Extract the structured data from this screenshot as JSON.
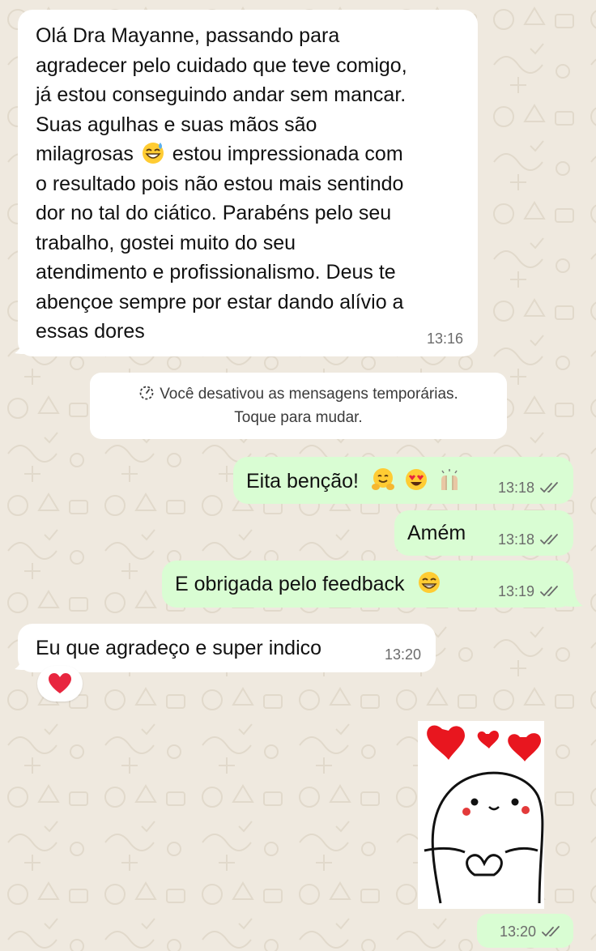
{
  "chat": {
    "messages": [
      {
        "direction": "incoming",
        "lines": [
          "Olá Dra Mayanne, passando para",
          "agradecer pelo cuidado que teve comigo,",
          "já estou conseguindo andar sem mancar.",
          "Suas agulhas e suas mãos são",
          "estou impressionada com",
          "o resultado pois não estou mais sentindo",
          "dor no tal do ciático. Parabéns pelo seu",
          "trabalho, gostei muito do seu",
          "atendimento e profissionalismo. Deus te",
          "abençoe sempre por estar dando alívio a",
          "essas dores"
        ],
        "line5_prefix": "milagrosas",
        "inline_emoji": "grinning-sweat-emoji",
        "time": "13:16"
      },
      {
        "direction": "outgoing",
        "text": "Eita benção!",
        "emojis": [
          "hugging-face-emoji",
          "heart-eyes-emoji",
          "raising-hands-emoji"
        ],
        "time": "13:18",
        "status": "read"
      },
      {
        "direction": "outgoing",
        "text": "Amém",
        "time": "13:18",
        "status": "read"
      },
      {
        "direction": "outgoing",
        "text": "E obrigada pelo feedback",
        "emojis": [
          "beaming-grin-emoji"
        ],
        "time": "13:19",
        "status": "read"
      },
      {
        "direction": "incoming",
        "text": "Eu que agradeço e super indico",
        "time": "13:20",
        "reaction": "red-heart-emoji"
      },
      {
        "direction": "outgoing",
        "type": "sticker",
        "sticker": "heart-hands-blob-sticker",
        "time": "13:20",
        "status": "read"
      }
    ],
    "system_notice": {
      "line1": "Você desativou as mensagens temporárias.",
      "line2": "Toque para mudar.",
      "icon": "timer-off-icon"
    }
  },
  "colors": {
    "background": "#efe9df",
    "incoming_bubble": "#ffffff",
    "outgoing_bubble": "#d9fdd3",
    "timestamp": "#6b6b6b",
    "read_ticks": "#6b6b6b"
  }
}
